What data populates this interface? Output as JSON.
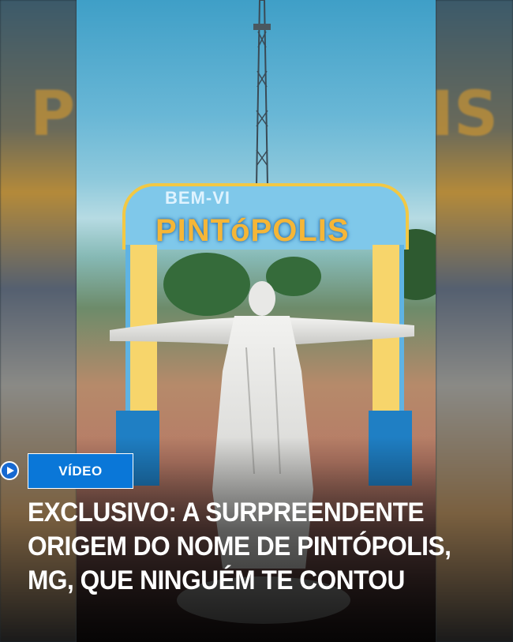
{
  "image": {
    "arch_welcome_text": "BEM-VI",
    "arch_name_text": "PINTóPOLIS",
    "side_ghost_left": "P",
    "side_ghost_right": "IS"
  },
  "badge": {
    "play_icon": "play-circle-icon",
    "label": "VÍDEO",
    "color": "#0a77d8"
  },
  "headline": {
    "text": "EXCLUSIVO: A SURPREENDENTE ORIGEM DO NOME DE PINTÓPOLIS, MG, QUE NINGUÉM TE CONTOU"
  }
}
